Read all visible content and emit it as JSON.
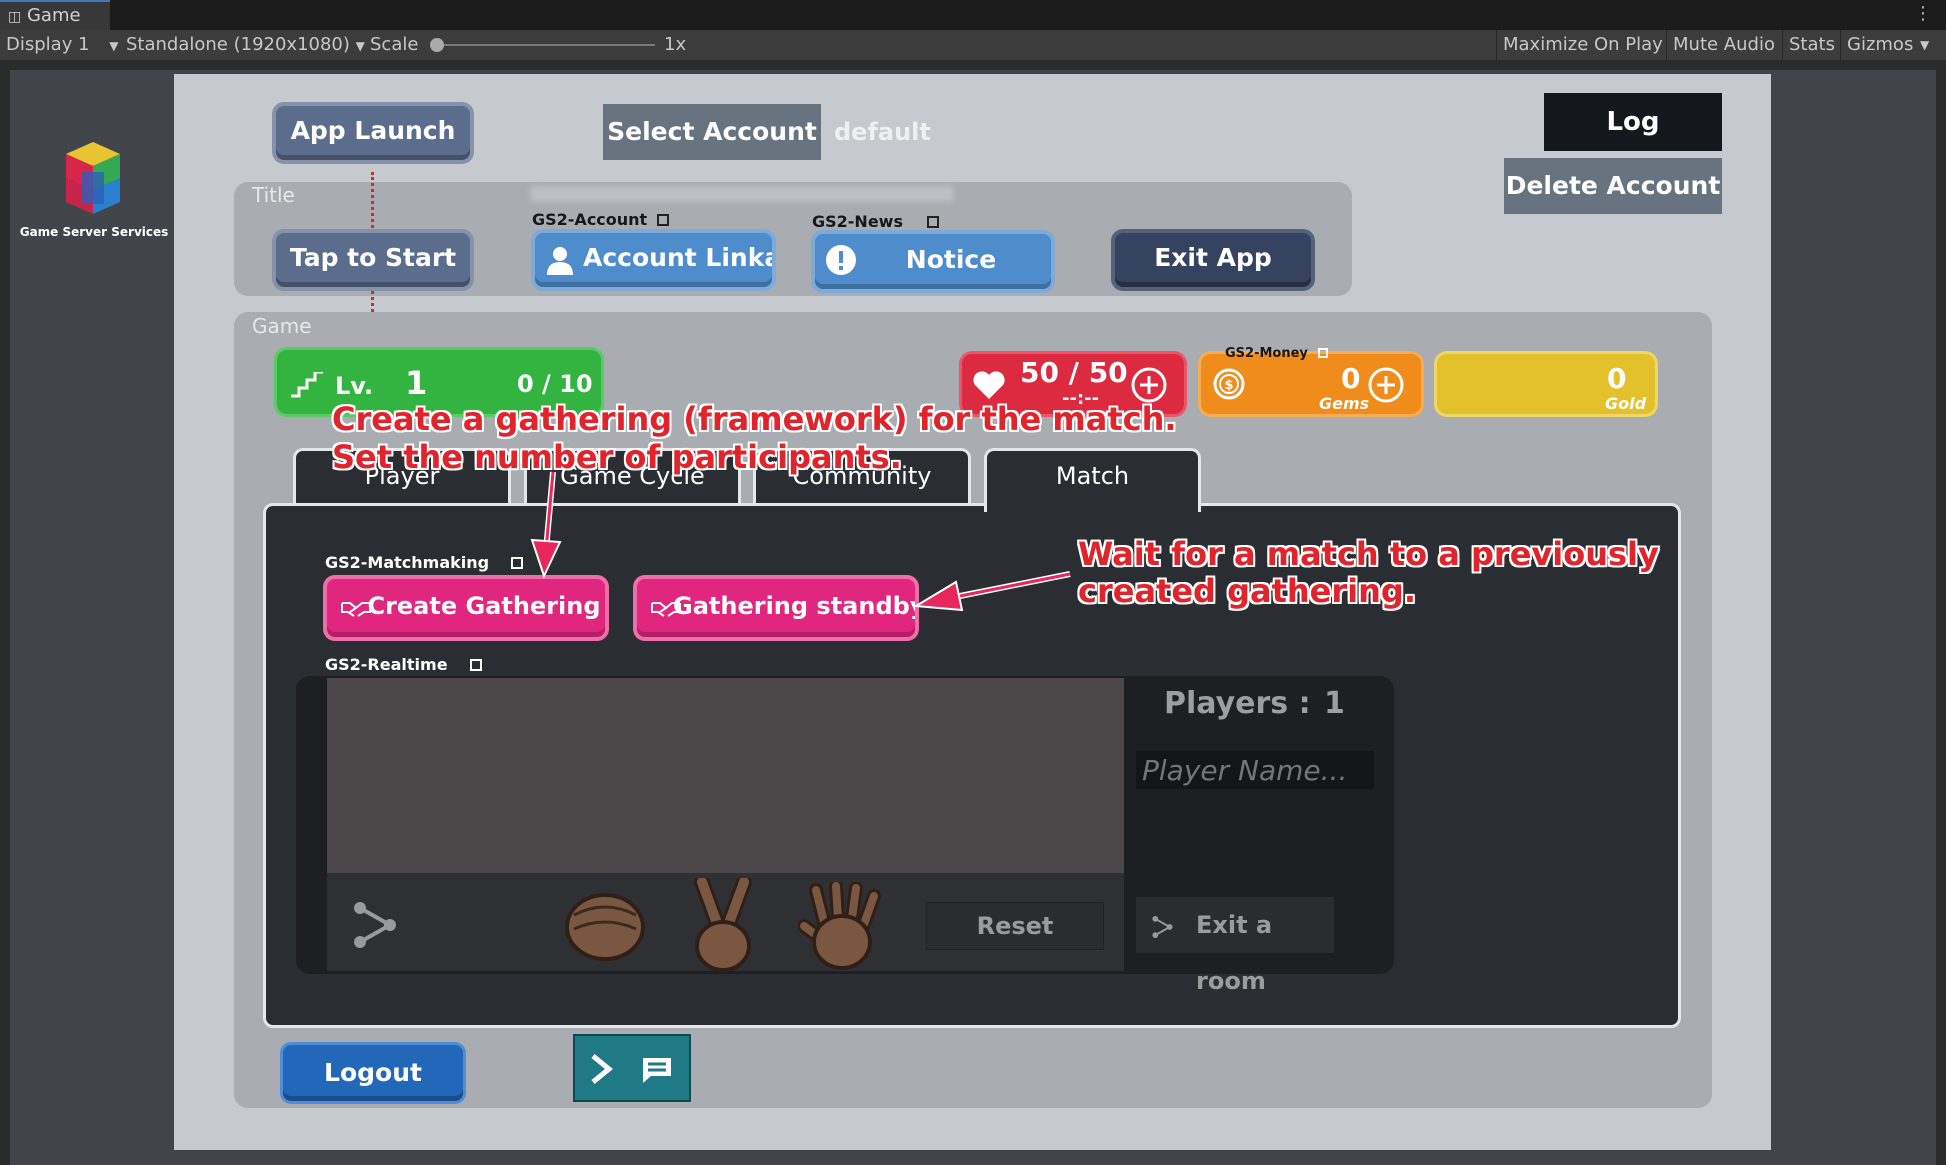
{
  "editor": {
    "tab_label": "Game",
    "display": "Display 1",
    "resolution": "Standalone (1920x1080)",
    "scale_label": "Scale",
    "scale_value": "1x",
    "maximize_on_play": "Maximize On Play",
    "mute_audio": "Mute Audio",
    "stats": "Stats",
    "gizmos": "Gizmos"
  },
  "logo": {
    "text": "Game Server Services"
  },
  "top": {
    "app_launch": "App Launch",
    "select_account": "Select Account",
    "account_name": "default",
    "log": "Log",
    "delete_account": "Delete Account"
  },
  "title_section": {
    "label": "Title",
    "tap_to_start": "Tap to Start",
    "account_tag": "GS2-Account",
    "account_linkage": "Account Linkage",
    "news_tag": "GS2-News",
    "notice": "Notice",
    "exit_app": "Exit App"
  },
  "game_section": {
    "label": "Game",
    "level_prefix": "Lv.",
    "level": "1",
    "exp": "0 / 10",
    "stamina": "50 / 50",
    "stamina_timer": "--:--",
    "money_tag": "GS2-Money",
    "gems_value": "0",
    "gems_label": "Gems",
    "gold_value": "0",
    "gold_label": "Gold"
  },
  "tabs": [
    "Player",
    "Game Cycle",
    "Community",
    "Match"
  ],
  "match": {
    "matchmaking_tag": "GS2-Matchmaking",
    "create_gathering": "Create Gathering",
    "gathering_standby": "Gathering standby",
    "realtime_tag": "GS2-Realtime",
    "players_label": "Players :",
    "players_count": "1",
    "player_name_placeholder": "Player Name...",
    "reset": "Reset",
    "exit_room": "Exit a room"
  },
  "bottom": {
    "logout": "Logout"
  },
  "annotations": {
    "create_line1": "Create a gathering (framework) for the match.",
    "create_line2": "Set the number of participants.",
    "standby_line1": "Wait for a match to a previously",
    "standby_line2": "created gathering."
  },
  "colors": {
    "level_green": "#33b33f",
    "stamina_red": "#dc2a40",
    "gems_orange": "#f08c1c",
    "gold_yellow": "#e3c12c",
    "match_pink": "#e0267f",
    "annotation_red": "#e0242c"
  },
  "icons": [
    "gamepad-icon",
    "gs2-logo-icon",
    "user-icon",
    "alert-icon",
    "external-link-icon",
    "stairs-icon",
    "heart-icon",
    "plus-circle-icon",
    "coin-icon",
    "handshake-icon",
    "share-icon",
    "rock-hand-icon",
    "scissors-hand-icon",
    "paper-hand-icon",
    "terminal-icon",
    "chat-icon"
  ]
}
